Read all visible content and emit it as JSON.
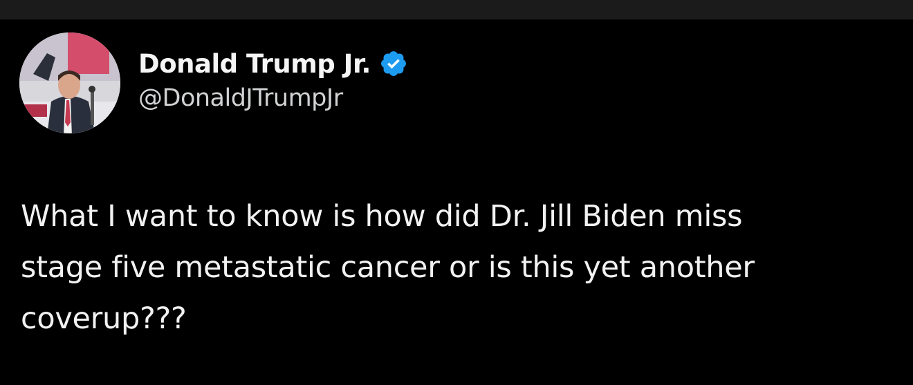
{
  "tweet": {
    "author": {
      "display_name": "Donald Trump Jr.",
      "handle": "@DonaldJTrumpJr",
      "verified": true,
      "verified_color": "#1d9bf0"
    },
    "text_lines": [
      "What I want to know is how did Dr. Jill Biden miss",
      "stage five metastatic cancer or is this yet another",
      "coverup???"
    ]
  },
  "theme": {
    "background": "#000000",
    "text": "#f2f2f2"
  }
}
